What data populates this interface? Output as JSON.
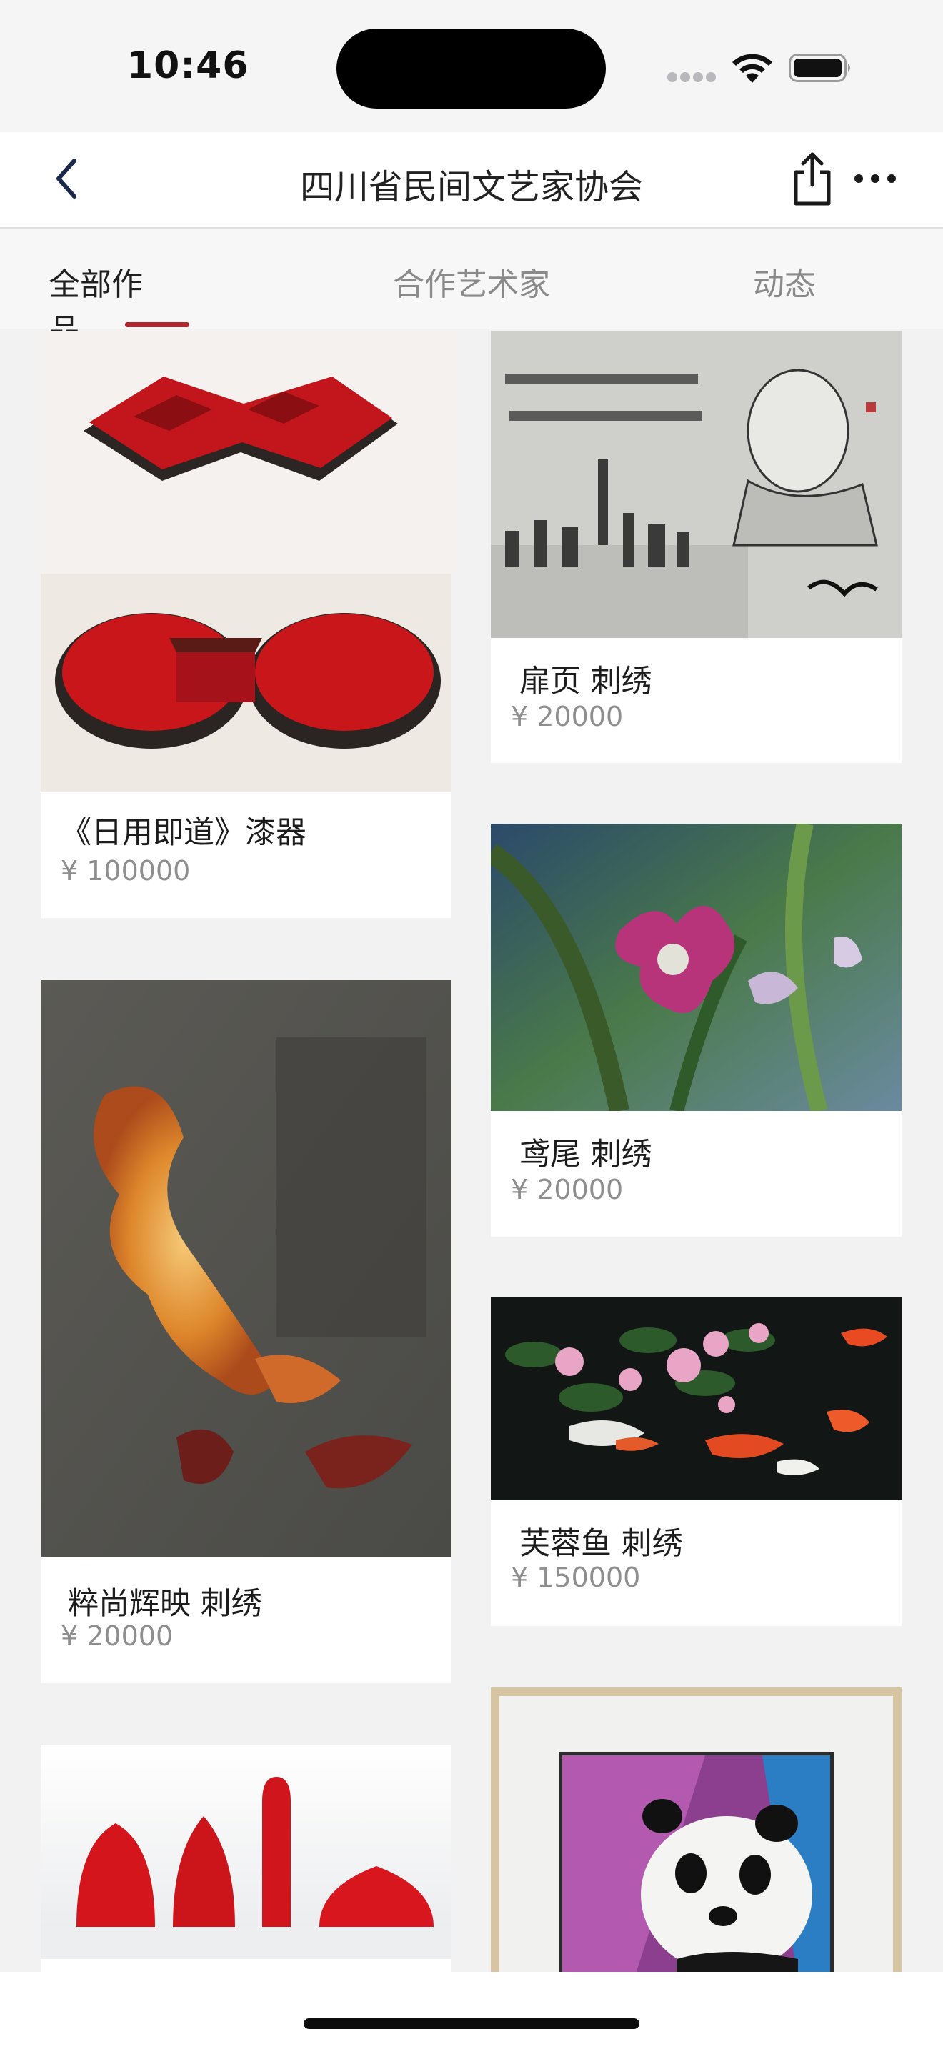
{
  "status_bar": {
    "time": "10:46"
  },
  "nav": {
    "title": "四川省民间文艺家协会"
  },
  "tabs": [
    {
      "label": "全部作品",
      "active": true
    },
    {
      "label": "合作艺术家",
      "active": false
    },
    {
      "label": "动态",
      "active": false
    }
  ],
  "works": {
    "left": [
      {
        "title": "《日用即道》漆器",
        "price": "¥ 100000"
      },
      {
        "title": "粹尚辉映 刺绣",
        "price": "¥ 20000"
      },
      {
        "title": "",
        "price": ""
      }
    ],
    "right": [
      {
        "title": "扉页 刺绣",
        "price": "¥ 20000"
      },
      {
        "title": "鸢尾 刺绣",
        "price": "¥ 20000"
      },
      {
        "title": "芙蓉鱼 刺绣",
        "price": "¥ 150000"
      },
      {
        "title": "",
        "price": ""
      }
    ]
  },
  "colors": {
    "accent": "#b1272d",
    "background": "#f2f2f3",
    "card": "#ffffff"
  },
  "icons": [
    "back-chevron-icon",
    "share-icon",
    "more-icon",
    "wifi-icon",
    "battery-icon",
    "signal-icon"
  ]
}
